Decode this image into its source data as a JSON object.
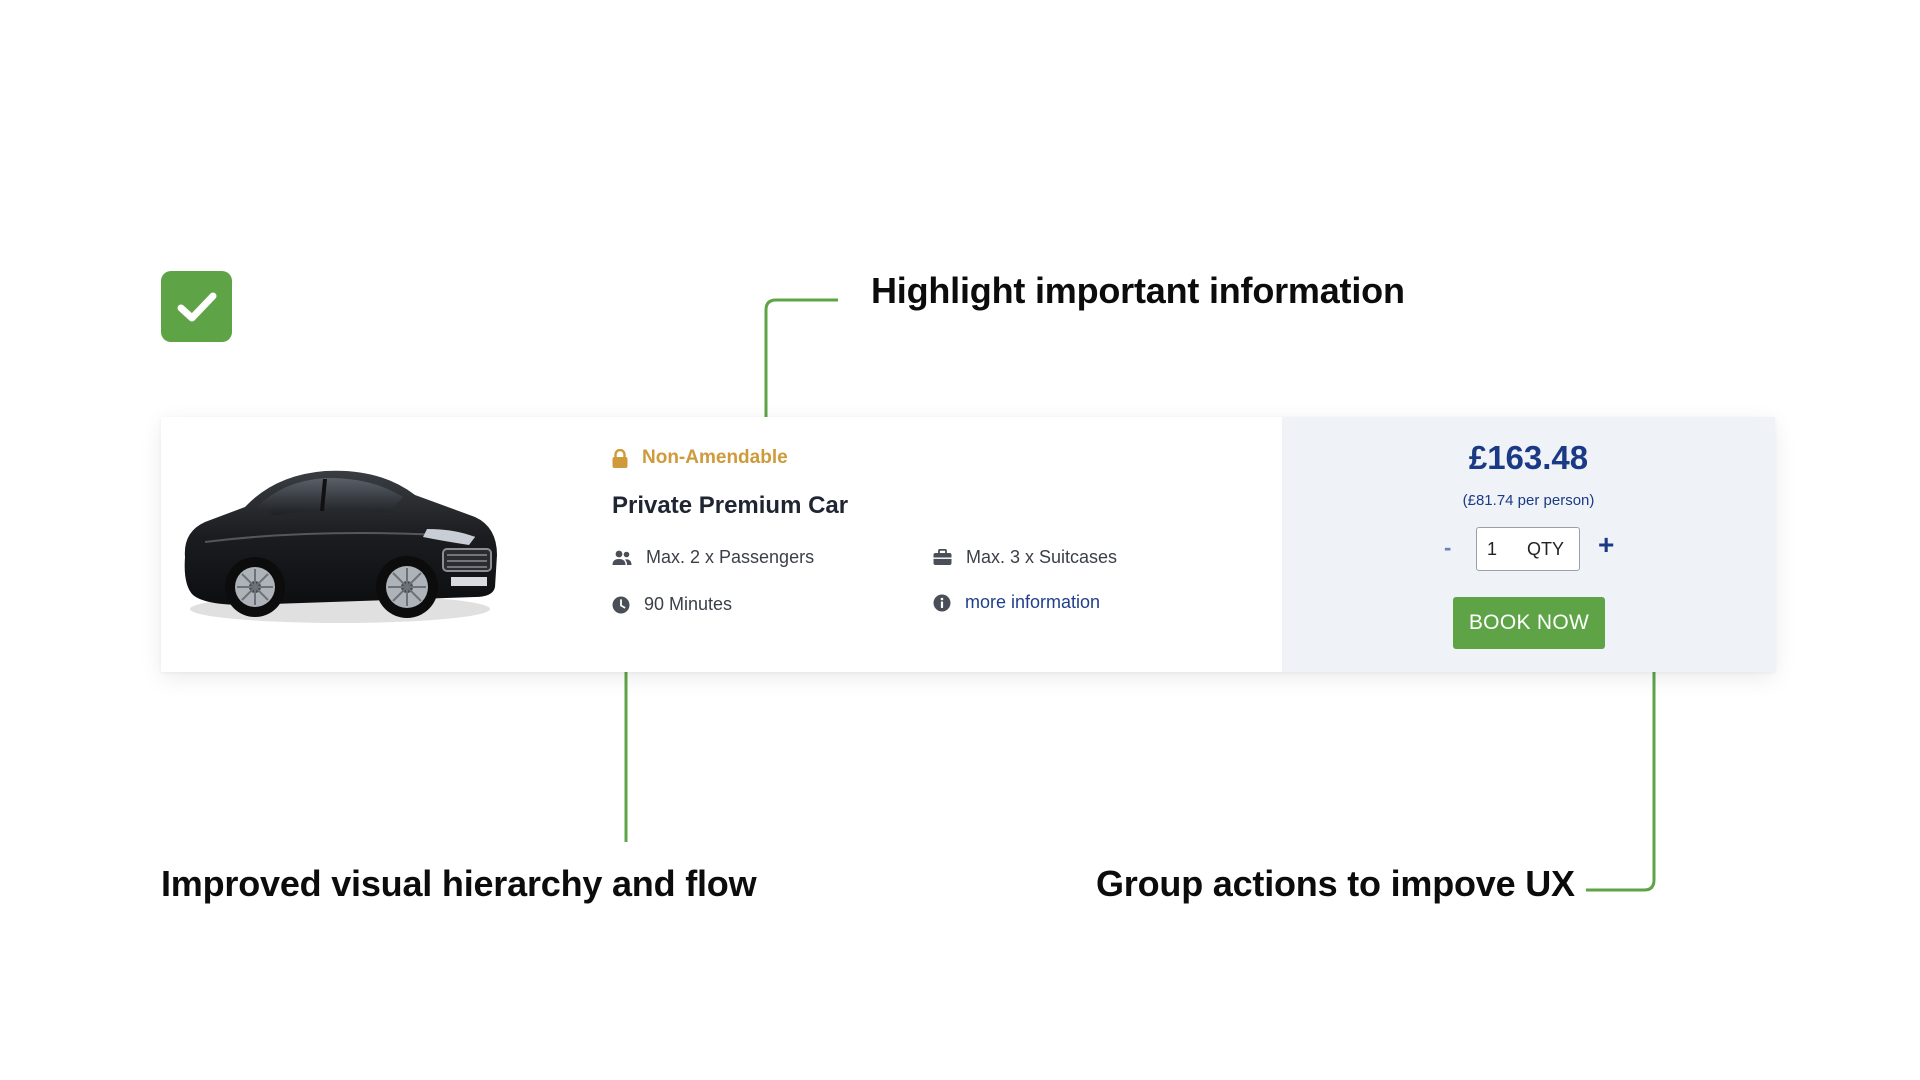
{
  "annotations": {
    "highlight": "Highlight important information",
    "hierarchy": "Improved visual hierarchy and flow",
    "group_actions": "Group actions to impove UX"
  },
  "product": {
    "badge": "Non-Amendable",
    "title": "Private Premium Car",
    "features": {
      "passengers": "Max. 2 x Passengers",
      "suitcases": "Max. 3 x Suitcases",
      "duration": "90 Minutes",
      "more_info": "more information"
    }
  },
  "pricing": {
    "price": "£163.48",
    "per_person": "(£81.74 per person)",
    "qty_minus": "-",
    "qty_value": "1",
    "qty_label": "QTY",
    "qty_plus": "+",
    "book_label": "BOOK NOW"
  },
  "colors": {
    "accent_green": "#5ea447",
    "price_blue": "#1b3a86",
    "warning_amber": "#cf9a3a",
    "price_panel_bg": "#eff2f7"
  },
  "icons": [
    "check-icon",
    "lock-icon",
    "passengers-icon",
    "suitcase-icon",
    "clock-icon",
    "info-icon"
  ]
}
